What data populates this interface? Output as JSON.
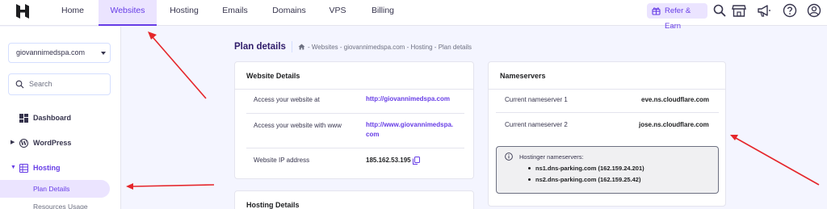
{
  "topnav": {
    "tabs": [
      {
        "label": "Home",
        "active": false
      },
      {
        "label": "Websites",
        "active": true
      },
      {
        "label": "Hosting",
        "active": false
      },
      {
        "label": "Emails",
        "active": false
      },
      {
        "label": "Domains",
        "active": false
      },
      {
        "label": "VPS",
        "active": false
      },
      {
        "label": "Billing",
        "active": false
      }
    ],
    "refer_label": "Refer & Earn",
    "icons": [
      "search-icon",
      "store-icon",
      "megaphone-icon",
      "help-icon",
      "account-icon"
    ]
  },
  "sidebar": {
    "site_select": "giovannimedspa.com",
    "search_placeholder": "Search",
    "items": [
      {
        "label": "Dashboard",
        "icon": "dashboard-icon"
      },
      {
        "label": "WordPress",
        "icon": "wordpress-icon"
      },
      {
        "label": "Hosting",
        "icon": "hosting-icon"
      }
    ],
    "sub_items": [
      {
        "label": "Plan Details",
        "active": true
      },
      {
        "label": "Resources Usage",
        "active": false
      }
    ]
  },
  "main": {
    "page_title": "Plan details",
    "breadcrumb": "- Websites - giovannimedspa.com - Hosting - Plan details",
    "website_details": {
      "title": "Website Details",
      "rows": [
        {
          "label": "Access your website at",
          "value": "http://giovannimedspa.com"
        },
        {
          "label": "Access your website with www",
          "value_line1": "http://www.giovannimedspa.",
          "value_line2": "com"
        },
        {
          "label": "Website IP address",
          "value": "185.162.53.195"
        }
      ]
    },
    "nameservers": {
      "title": "Nameservers",
      "rows": [
        {
          "label": "Current nameserver 1",
          "value": "eve.ns.cloudflare.com"
        },
        {
          "label": "Current nameserver 2",
          "value": "jose.ns.cloudflare.com"
        }
      ],
      "info_title": "Hostinger nameservers:",
      "info_items": [
        "ns1.dns-parking.com (162.159.24.201)",
        "ns2.dns-parking.com (162.159.25.42)"
      ]
    },
    "hosting_details": {
      "title": "Hosting Details"
    }
  },
  "colors": {
    "accent": "#673de6",
    "accent_light": "#ebe4ff",
    "annotation_arrow": "#e5262b"
  }
}
